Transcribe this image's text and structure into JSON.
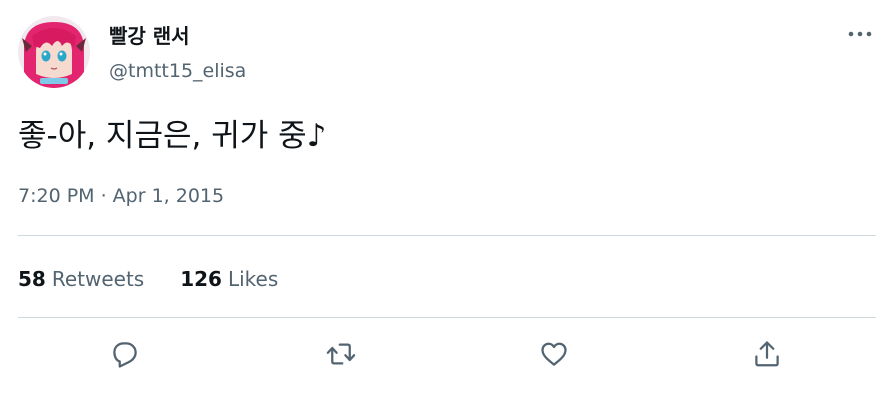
{
  "author": {
    "display_name": "빨강 랜서",
    "handle": "@tmtt15_elisa"
  },
  "tweet": {
    "text": "좋-아, 지금은, 귀가 중♪",
    "timestamp": "7:20 PM · Apr 1, 2015"
  },
  "stats": {
    "retweets_count": "58",
    "retweets_label": "Retweets",
    "likes_count": "126",
    "likes_label": "Likes"
  },
  "icons": {
    "more": "more-icon",
    "reply": "reply-icon",
    "retweet": "retweet-icon",
    "like": "heart-icon",
    "share": "share-icon"
  },
  "colors": {
    "text_primary": "#0f1419",
    "text_secondary": "#536471",
    "divider": "#cfd9de",
    "avatar_hair": "#e3246e"
  }
}
